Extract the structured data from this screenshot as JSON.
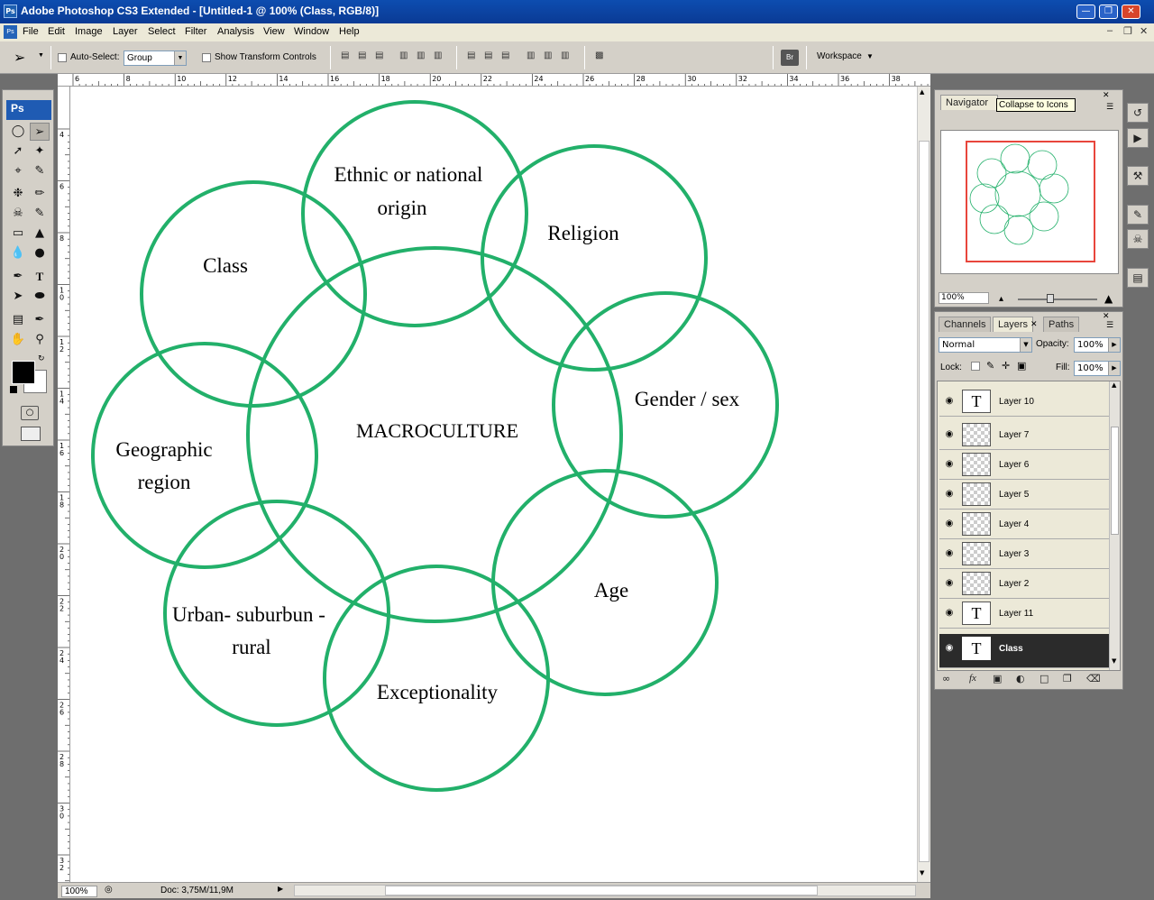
{
  "window": {
    "title": "Adobe Photoshop CS3 Extended - [Untitled-1 @ 100% (Class, RGB/8)]",
    "app_icon": "Ps"
  },
  "menu": [
    "File",
    "Edit",
    "Image",
    "Layer",
    "Select",
    "Filter",
    "Analysis",
    "View",
    "Window",
    "Help"
  ],
  "options": {
    "auto_select_label": "Auto-Select:",
    "auto_select_value": "Group",
    "show_transform_label": "Show Transform Controls",
    "workspace_label": "Workspace",
    "bridge_label": "Br"
  },
  "ruler": {
    "h_labels": [
      "6",
      "8",
      "10",
      "12",
      "14",
      "16",
      "18",
      "20",
      "22",
      "24",
      "26",
      "28",
      "30",
      "32",
      "34",
      "36",
      "38"
    ],
    "v_labels": [
      "4",
      "6",
      "8",
      "10",
      "12",
      "14",
      "16",
      "18",
      "20",
      "22",
      "24",
      "26",
      "28",
      "30",
      "32"
    ]
  },
  "diagram": {
    "center_label": "MACROCULTURE",
    "circle_color": "#22b06a",
    "labels": {
      "ethnic_1": "Ethnic or national",
      "ethnic_2": "origin",
      "religion": "Religion",
      "gender": "Gender / sex",
      "age": "Age",
      "exceptionality": "Exceptionality",
      "urban_1": "Urban- suburbun -",
      "urban_2": "rural",
      "geo_1": "Geographic",
      "geo_2": "region",
      "class": "Class"
    }
  },
  "status": {
    "zoom": "100%",
    "doc": "Doc: 3,75M/11,9M"
  },
  "navigator": {
    "tab": "Navigator",
    "tooltip": "Collapse to Icons",
    "zoom": "100%",
    "frame_color": "#e8463c"
  },
  "layers_panel": {
    "tabs": [
      "Channels",
      "Layers",
      "Paths"
    ],
    "blend_mode": "Normal",
    "opacity_label": "Opacity:",
    "opacity_value": "100%",
    "lock_label": "Lock:",
    "fill_label": "Fill:",
    "fill_value": "100%",
    "layers": [
      {
        "name": "Layer 10",
        "type": "text"
      },
      {
        "name": "Layer 7",
        "type": "raster"
      },
      {
        "name": "Layer 6",
        "type": "raster"
      },
      {
        "name": "Layer 5",
        "type": "raster"
      },
      {
        "name": "Layer 4",
        "type": "raster"
      },
      {
        "name": "Layer 3",
        "type": "raster"
      },
      {
        "name": "Layer 2",
        "type": "raster"
      },
      {
        "name": "Layer 11",
        "type": "text"
      },
      {
        "name": "Class",
        "type": "text",
        "selected": true
      }
    ]
  }
}
